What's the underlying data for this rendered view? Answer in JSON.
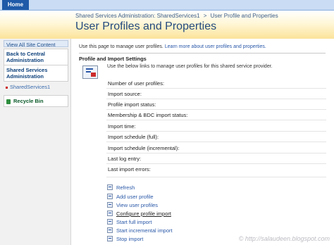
{
  "topbar": {
    "home_tab": "Home"
  },
  "header": {
    "breadcrumb": [
      "Shared Services Administration: SharedServices1",
      ">",
      "User Profile and Properties"
    ],
    "title": "User Profiles and Properties"
  },
  "leftnav": {
    "view_all": "View All Site Content",
    "back_central": "Back to Central Administration",
    "shared_services_admin": "Shared Services Administration",
    "shared_services_1": "SharedServices1",
    "recycle_bin": "Recycle Bin"
  },
  "main": {
    "intro_text": "Use this page to manage user profiles.",
    "intro_link": "Learn more about user profiles and properties.",
    "section_title": "Profile and Import Settings",
    "section_desc": "Use the below links to manage user profiles for this shared service provider.",
    "properties": [
      "Number of user profiles:",
      "Import source:",
      "Profile import status:",
      "Membership & BDC import status:",
      "Import time:",
      "Import schedule (full):",
      "Import schedule (incremental):",
      "Last log entry:",
      "Last import errors:"
    ],
    "actions": [
      "Refresh",
      "Add user profile",
      "View user profiles",
      "Configure profile import",
      "Start full import",
      "Start incremental import",
      "Stop import"
    ]
  },
  "watermark": "© http://salaudeen.blogspot.com"
}
